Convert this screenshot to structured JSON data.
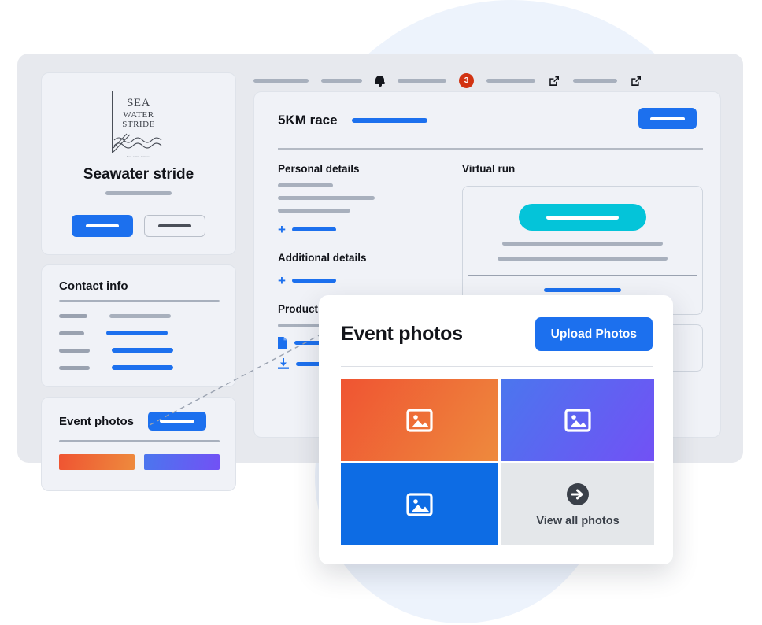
{
  "colors": {
    "accent_blue": "#1c70ee",
    "tile_blue": "#0d6ce4",
    "teal": "#04c4d9",
    "badge_red": "#d23312",
    "orange_start": "#ef5432",
    "orange_end": "#ee8a3d",
    "purple_start": "#4b76ee",
    "purple_end": "#7251f5",
    "gray_tile": "#e4e7ea",
    "window_bg": "#e7e9ee",
    "card_bg": "#f0f2f7",
    "blob": "#eaf1fb"
  },
  "topnav": {
    "bell_icon": "bell-icon",
    "notification_count": "3",
    "external_link_icon": "external-link-icon"
  },
  "sidebar": {
    "profile": {
      "logo": {
        "line1": "SEA",
        "line2": "WATER",
        "line3": "STRIDE",
        "caption": "Run. swim. sunrise."
      },
      "name": "Seawater stride",
      "primary_button": "",
      "secondary_button": ""
    },
    "contact": {
      "title": "Contact info"
    },
    "photos": {
      "title": "Event photos"
    }
  },
  "main": {
    "title": "5KM race",
    "sections": {
      "personal_details": "Personal details",
      "additional_details": "Additional details",
      "product": "Product",
      "virtual_run": "Virtual run"
    },
    "icons": {
      "add": "+",
      "document": "document-icon",
      "download": "download-icon"
    }
  },
  "modal": {
    "title": "Event photos",
    "upload_button": "Upload Photos",
    "tiles": [
      {
        "name": "photo-tile-1",
        "icon": "image-icon"
      },
      {
        "name": "photo-tile-2",
        "icon": "image-icon"
      },
      {
        "name": "photo-tile-3",
        "icon": "image-icon"
      },
      {
        "name": "view-all-tile",
        "icon": "arrow-right-circle-icon",
        "label": "View all photos"
      }
    ]
  }
}
